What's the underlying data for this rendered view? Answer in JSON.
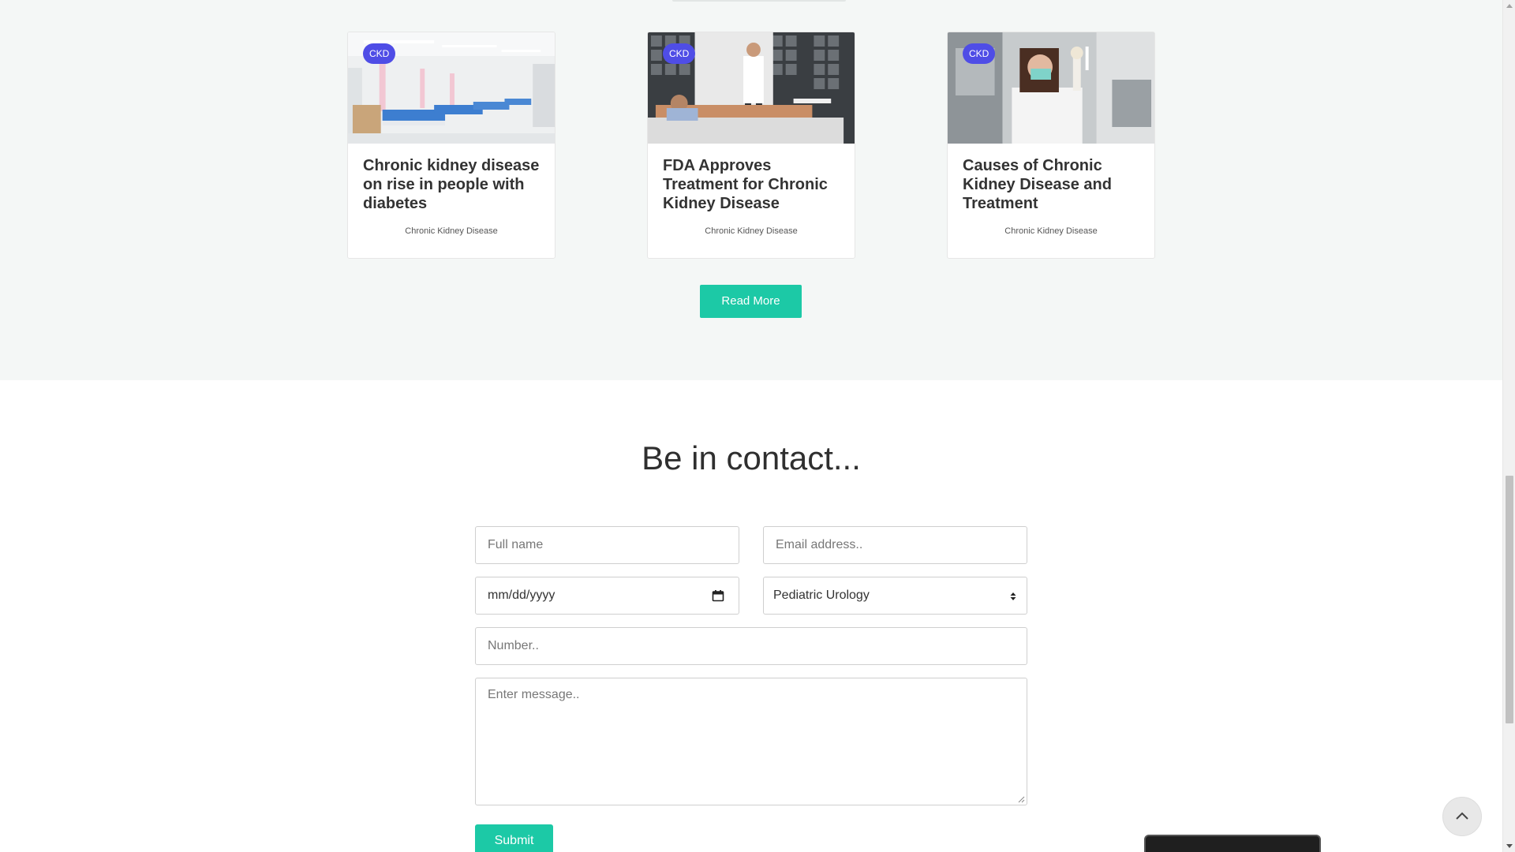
{
  "blog": {
    "cards": [
      {
        "badge": "CKD",
        "title": "Chronic kidney disease on rise in people with diabetes",
        "category": "Chronic Kidney Disease",
        "image": "hospital-ward-photo"
      },
      {
        "badge": "CKD",
        "title": "FDA Approves Treatment for Chronic Kidney Disease",
        "category": "Chronic Kidney Disease",
        "image": "doctor-and-patient-photo"
      },
      {
        "badge": "CKD",
        "title": "Causes of Chronic Kidney Disease and Treatment",
        "category": "Chronic Kidney Disease",
        "image": "lab-scientist-photo"
      }
    ],
    "read_more_label": "Read More"
  },
  "contact": {
    "title": "Be in contact...",
    "full_name_placeholder": "Full name",
    "email_placeholder": "Email address..",
    "date_placeholder": "mm/dd/yyyy",
    "department_selected": "Pediatric Urology",
    "number_placeholder": "Number..",
    "message_placeholder": "Enter message..",
    "submit_label": "Submit"
  },
  "colors": {
    "accent": "#1cc9a6",
    "badge": "#4f4de6",
    "section_bg": "#f4f7f6"
  },
  "icons": {
    "calendar": "calendar-icon",
    "select": "select-arrows-icon",
    "scroll_top": "chevron-up-icon"
  }
}
